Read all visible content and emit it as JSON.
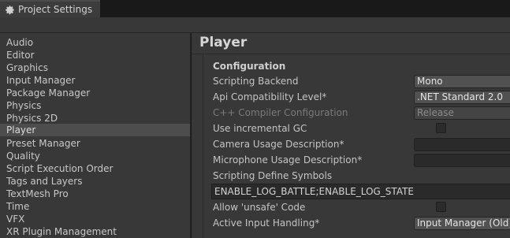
{
  "window": {
    "tab_title": "Project Settings"
  },
  "sidebar": {
    "items": [
      {
        "label": "Audio"
      },
      {
        "label": "Editor"
      },
      {
        "label": "Graphics"
      },
      {
        "label": "Input Manager"
      },
      {
        "label": "Package Manager"
      },
      {
        "label": "Physics"
      },
      {
        "label": "Physics 2D"
      },
      {
        "label": "Player",
        "selected": true
      },
      {
        "label": "Preset Manager"
      },
      {
        "label": "Quality"
      },
      {
        "label": "Script Execution Order"
      },
      {
        "label": "Tags and Layers"
      },
      {
        "label": "TextMesh Pro"
      },
      {
        "label": "Time"
      },
      {
        "label": "VFX"
      },
      {
        "label": "XR Plugin Management"
      }
    ]
  },
  "main": {
    "title": "Player",
    "section": "Configuration",
    "rows": {
      "scripting_backend": {
        "label": "Scripting Backend",
        "value": "Mono"
      },
      "api_compat": {
        "label": "Api Compatibility Level*",
        "value": ".NET Standard 2.0"
      },
      "cpp_compiler": {
        "label": "C++ Compiler Configuration",
        "value": "Release",
        "disabled": true
      },
      "incremental_gc": {
        "label": "Use incremental GC",
        "checked": false
      },
      "camera_usage": {
        "label": "Camera Usage Description*",
        "value": ""
      },
      "microphone_usage": {
        "label": "Microphone Usage Description*",
        "value": ""
      },
      "define_symbols": {
        "label": "Scripting Define Symbols",
        "value": "ENABLE_LOG_BATTLE;ENABLE_LOG_STATE"
      },
      "allow_unsafe": {
        "label": "Allow 'unsafe' Code",
        "checked": false
      },
      "input_handling": {
        "label": "Active Input Handling*",
        "value": "Input Manager (Old)"
      }
    }
  },
  "colors": {
    "selected_item_bg": "#4d4d4d",
    "panel_bg": "#383838"
  }
}
